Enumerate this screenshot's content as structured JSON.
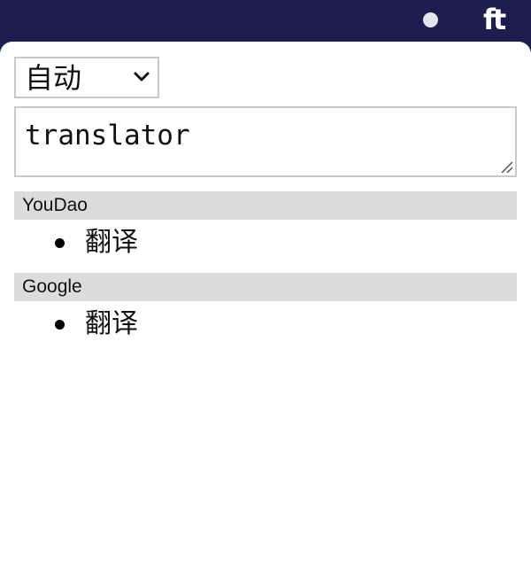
{
  "menubar": {
    "status_icon": "circle-icon",
    "app_icon": "ft-logo-icon",
    "app_logo_text": "ft"
  },
  "language_select": {
    "value": "自动",
    "icon": "chevron-down-icon"
  },
  "source_input": {
    "value": "translator",
    "icon": "resize-handle-icon"
  },
  "results": [
    {
      "provider": "YouDao",
      "translations": [
        "翻译"
      ]
    },
    {
      "provider": "Google",
      "translations": [
        "翻译"
      ]
    }
  ],
  "colors": {
    "menubar_bg": "#1c1d4e",
    "popup_bg": "#ffffff",
    "section_header_bg": "#dcdcdc",
    "border": "#c9c9c9"
  }
}
